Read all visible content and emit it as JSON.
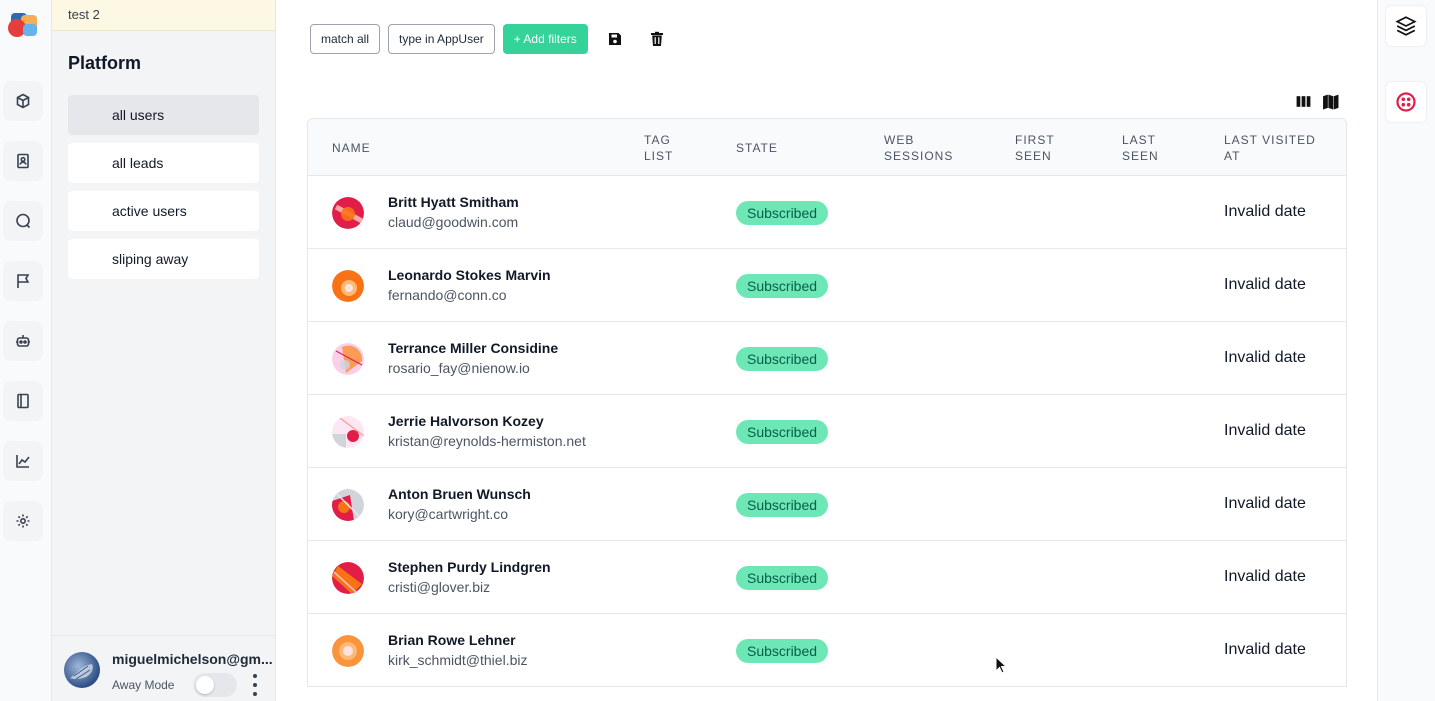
{
  "sidebar": {
    "app_name": "test 2",
    "section_title": "Platform",
    "segments": [
      {
        "label": "all users",
        "active": true
      },
      {
        "label": "all leads",
        "active": false
      },
      {
        "label": "active users",
        "active": false
      },
      {
        "label": "sliping away",
        "active": false
      }
    ],
    "user": {
      "name": "miguelmichelson@gm...",
      "away_label": "Away Mode"
    }
  },
  "rail": {
    "icons": [
      "cube-icon",
      "contacts-icon",
      "chat-icon",
      "flag-icon",
      "bot-icon",
      "book-icon",
      "chart-icon",
      "gear-icon"
    ]
  },
  "filters": {
    "match_label": "match all",
    "type_label": "type in AppUser",
    "add_label": "+ Add filters"
  },
  "table": {
    "headers": {
      "name": "NAME",
      "tag_list": [
        "TAG",
        "LIST"
      ],
      "state": "STATE",
      "web_sessions": [
        "WEB",
        "SESSIONS"
      ],
      "first_seen": [
        "FIRST",
        "SEEN"
      ],
      "last_seen": [
        "LAST",
        "SEEN"
      ],
      "last_visited": [
        "LAST VISITED",
        "AT"
      ]
    },
    "rows": [
      {
        "name": "Britt Hyatt Smitham",
        "email": "claud@goodwin.com",
        "state": "Subscribed",
        "last_visited": "Invalid date"
      },
      {
        "name": "Leonardo Stokes Marvin",
        "email": "fernando@conn.co",
        "state": "Subscribed",
        "last_visited": "Invalid date"
      },
      {
        "name": "Terrance Miller Considine",
        "email": "rosario_fay@nienow.io",
        "state": "Subscribed",
        "last_visited": "Invalid date"
      },
      {
        "name": "Jerrie Halvorson Kozey",
        "email": "kristan@reynolds-hermiston.net",
        "state": "Subscribed",
        "last_visited": "Invalid date"
      },
      {
        "name": "Anton Bruen Wunsch",
        "email": "kory@cartwright.co",
        "state": "Subscribed",
        "last_visited": "Invalid date"
      },
      {
        "name": "Stephen Purdy Lindgren",
        "email": "cristi@glover.biz",
        "state": "Subscribed",
        "last_visited": "Invalid date"
      },
      {
        "name": "Brian Rowe Lehner",
        "email": "kirk_schmidt@thiel.biz",
        "state": "Subscribed",
        "last_visited": "Invalid date"
      }
    ]
  },
  "colors": {
    "accent_green": "#34d399",
    "badge_bg": "#6ee7b7",
    "badge_text": "#065f46",
    "app_bar_bg": "#fdf8e4"
  }
}
